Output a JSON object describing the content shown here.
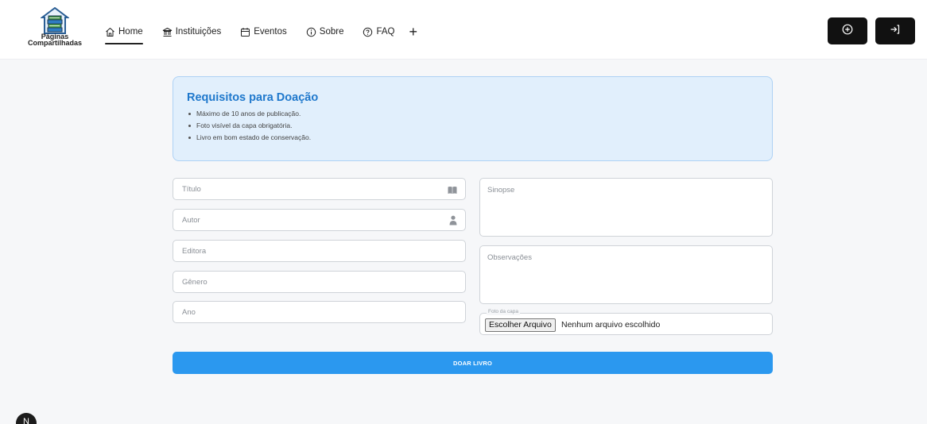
{
  "logo": {
    "line1": "Páginas",
    "line2": "Compartilhadas"
  },
  "nav": {
    "home": "Home",
    "instituicoes": "Instituições",
    "eventos": "Eventos",
    "sobre": "Sobre",
    "faq": "FAQ",
    "add_symbol": "+"
  },
  "requirements": {
    "title": "Requisitos para Doação",
    "items": [
      "Máximo de 10 anos de publicação.",
      "Foto visível da capa obrigatória.",
      "Livro em bom estado de conservação."
    ]
  },
  "form": {
    "titulo_placeholder": "Título",
    "autor_placeholder": "Autor",
    "editora_placeholder": "Editora",
    "genero_placeholder": "Gênero",
    "ano_placeholder": "Ano",
    "sinopse_placeholder": "Sinopse",
    "observacoes_placeholder": "Observações",
    "foto_label": "Foto da capa",
    "file_button": "Escolher Arquivo",
    "file_status": "Nenhum arquivo escolhido",
    "submit": "DOAR LIVRO"
  },
  "floating_button": {
    "label": "N"
  },
  "colors": {
    "accent": "#2b98ef",
    "requirements_bg": "#e1effc",
    "requirements_title": "#1f78cc",
    "header_buttons": "#111111"
  },
  "icons": {
    "home": "home-icon",
    "instituicoes": "bank-icon",
    "eventos": "calendar-icon",
    "sobre": "info-icon",
    "faq": "help-icon",
    "add_book": "plus-circle-icon",
    "login": "login-icon",
    "titulo": "book-icon",
    "autor": "user-icon"
  }
}
